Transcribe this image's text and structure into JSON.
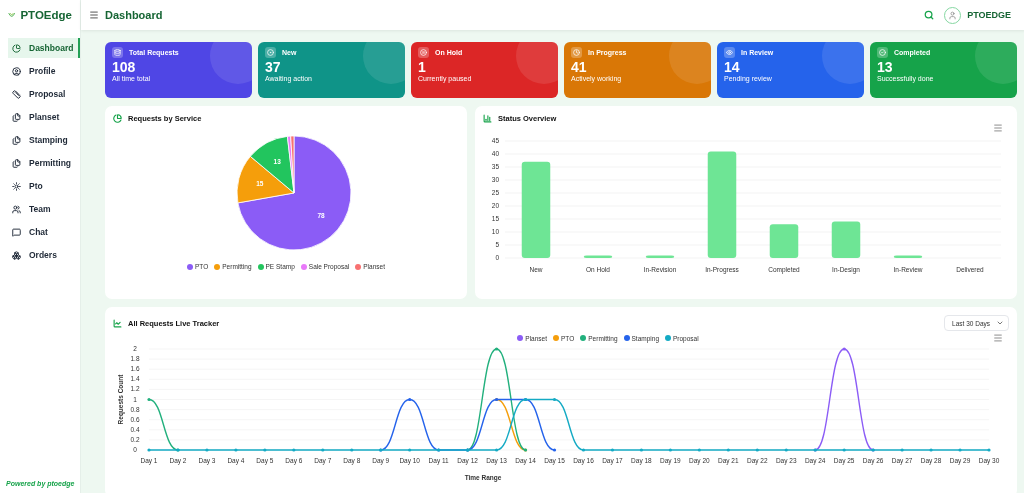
{
  "brand": {
    "name": "PTOEdge"
  },
  "sidebar": {
    "items": [
      {
        "label": "Dashboard",
        "selected": true
      },
      {
        "label": "Profile",
        "selected": false
      },
      {
        "label": "Proposal",
        "selected": false
      },
      {
        "label": "Planset",
        "selected": false
      },
      {
        "label": "Stamping",
        "selected": false
      },
      {
        "label": "Permitting",
        "selected": false
      },
      {
        "label": "Pto",
        "selected": false
      },
      {
        "label": "Team",
        "selected": false
      },
      {
        "label": "Chat",
        "selected": false
      },
      {
        "label": "Orders",
        "selected": false
      }
    ],
    "footer": "Powered by ptoedge"
  },
  "header": {
    "title": "Dashboard",
    "user": "PTOEDGE"
  },
  "cards": [
    {
      "title": "Total Requests",
      "value": "108",
      "caption": "All time total",
      "color": "#4f46e5"
    },
    {
      "title": "New",
      "value": "37",
      "caption": "Awaiting action",
      "color": "#0f9488"
    },
    {
      "title": "On Hold",
      "value": "1",
      "caption": "Currently paused",
      "color": "#dc2626"
    },
    {
      "title": "In Progress",
      "value": "41",
      "caption": "Actively working",
      "color": "#d97706"
    },
    {
      "title": "In Review",
      "value": "14",
      "caption": "Pending review",
      "color": "#2563eb"
    },
    {
      "title": "Completed",
      "value": "13",
      "caption": "Successfully done",
      "color": "#16a34a"
    }
  ],
  "service_panel": {
    "title": "Requests by Service",
    "chart_data": {
      "type": "pie",
      "categories": [
        "PTO",
        "Permitting",
        "PE Stamp",
        "Sale Proposal",
        "Planset"
      ],
      "values": [
        78,
        15,
        13,
        1,
        1
      ],
      "colors": [
        "#8b5cf6",
        "#f59e0b",
        "#22c55e",
        "#e879f9",
        "#f87171"
      ],
      "value_labels": [
        "78",
        "15",
        "13",
        null,
        null
      ]
    }
  },
  "status_panel": {
    "title": "Status Overview",
    "chart_data": {
      "type": "bar",
      "categories": [
        "New",
        "On Hold",
        "In-Revision",
        "In-Progress",
        "Completed",
        "In-Design",
        "In-Review",
        "Delivered"
      ],
      "values": [
        37,
        1,
        1,
        41,
        13,
        14,
        1,
        0
      ],
      "ylim": [
        0,
        45
      ],
      "yticks": [
        0,
        5,
        10,
        15,
        20,
        25,
        30,
        35,
        40,
        45
      ],
      "grid": true
    }
  },
  "tracker_panel": {
    "title": "All Requests Live Tracker",
    "range": "Last 30 Days",
    "chart_data": {
      "type": "line",
      "xlabel": "Time Range",
      "ylabel": "Requests Count",
      "categories": [
        "Day 1",
        "Day 2",
        "Day 3",
        "Day 4",
        "Day 5",
        "Day 6",
        "Day 7",
        "Day 8",
        "Day 9",
        "Day 10",
        "Day 11",
        "Day 12",
        "Day 13",
        "Day 14",
        "Day 15",
        "Day 16",
        "Day 17",
        "Day 18",
        "Day 19",
        "Day 20",
        "Day 21",
        "Day 22",
        "Day 23",
        "Day 24",
        "Day 25",
        "Day 26",
        "Day 27",
        "Day 28",
        "Day 29",
        "Day 30"
      ],
      "series": [
        {
          "name": "Planset",
          "color": "#8b5cf6",
          "values": [
            null,
            null,
            null,
            null,
            null,
            null,
            null,
            null,
            null,
            null,
            null,
            null,
            null,
            null,
            null,
            null,
            null,
            null,
            null,
            null,
            null,
            null,
            null,
            0,
            2,
            0,
            null,
            null,
            null,
            null
          ]
        },
        {
          "name": "PTO",
          "color": "#f59e0b",
          "values": [
            null,
            null,
            null,
            null,
            null,
            null,
            null,
            null,
            null,
            null,
            null,
            null,
            1,
            0,
            null,
            null,
            null,
            null,
            null,
            null,
            null,
            null,
            null,
            null,
            null,
            null,
            null,
            null,
            null,
            null
          ]
        },
        {
          "name": "Permitting",
          "color": "#22b07d",
          "values": [
            1,
            0,
            null,
            null,
            null,
            null,
            null,
            null,
            null,
            null,
            null,
            0,
            2,
            0,
            null,
            null,
            null,
            null,
            null,
            null,
            null,
            null,
            null,
            null,
            null,
            null,
            null,
            null,
            null,
            null
          ]
        },
        {
          "name": "Stamping",
          "color": "#2563eb",
          "values": [
            null,
            null,
            null,
            null,
            null,
            null,
            null,
            null,
            0,
            1,
            0,
            0,
            1,
            1,
            0,
            null,
            null,
            null,
            null,
            null,
            null,
            null,
            null,
            null,
            null,
            null,
            null,
            null,
            null,
            null
          ]
        },
        {
          "name": "Proposal",
          "color": "#14aac4",
          "values": [
            0,
            0,
            0,
            0,
            0,
            0,
            0,
            0,
            0,
            0,
            0,
            0,
            0,
            1,
            1,
            0,
            0,
            0,
            0,
            0,
            0,
            0,
            0,
            0,
            0,
            0,
            0,
            0,
            0,
            0
          ]
        }
      ],
      "ylim": [
        0,
        2
      ],
      "yticks": [
        0,
        0.2,
        0.4,
        0.6,
        0.8,
        1,
        1.2,
        1.4,
        1.6,
        1.8,
        2
      ],
      "grid": true
    }
  }
}
